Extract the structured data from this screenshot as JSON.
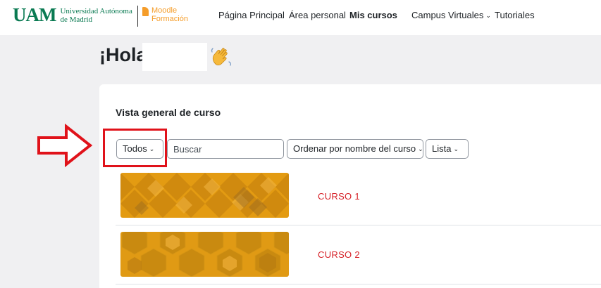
{
  "navbar": {
    "uam_mark": "UAM",
    "uam_line1": "Universidad Autónoma",
    "uam_line2": "de Madrid",
    "moodle_line1": "Moodle",
    "moodle_line2": "Formación",
    "items": [
      {
        "label": "Página Principal",
        "active": false
      },
      {
        "label": "Área personal",
        "active": false
      },
      {
        "label": "Mis cursos",
        "active": true
      },
      {
        "label": "Campus Virtuales",
        "active": false,
        "dropdown": true
      },
      {
        "label": "Tutoriales",
        "active": false
      }
    ]
  },
  "greeting": {
    "text": "¡Hola,",
    "icon": "waving-hand-icon"
  },
  "overview": {
    "title": "Vista general de curso",
    "filter_label": "Todos",
    "search_placeholder": "Buscar",
    "sort_label": "Ordenar por nombre del curso",
    "view_label": "Lista"
  },
  "courses": [
    {
      "name": "CURSO 1"
    },
    {
      "name": "CURSO 2"
    }
  ],
  "colors": {
    "uam_green": "#0a7a52",
    "moodle_orange": "#f59d2a",
    "annotation_red": "#e0121a",
    "course_text_red": "#d61f26",
    "course_gold": "#e39b12"
  }
}
